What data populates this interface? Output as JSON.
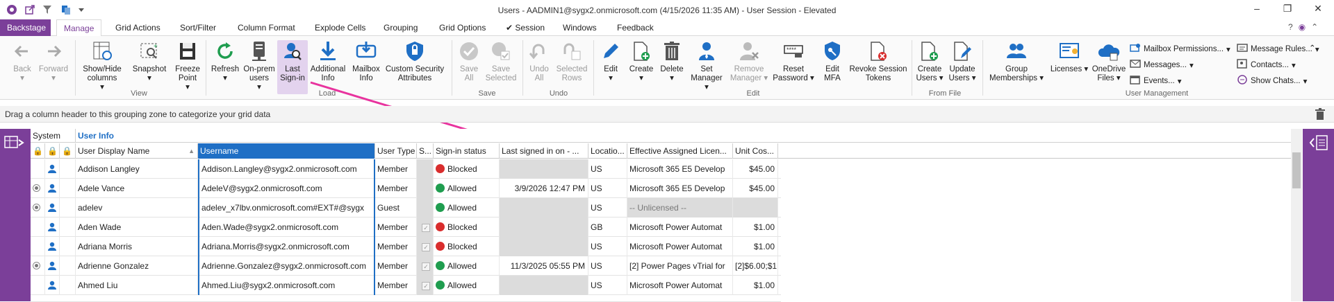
{
  "window": {
    "title": "Users - AADMIN1@sygx2.onmicrosoft.com (4/15/2026 11:35 AM) - User Session - Elevated"
  },
  "menu": {
    "tabs": [
      "Backstage",
      "Manage",
      "Grid Actions",
      "Sort/Filter",
      "Column Format",
      "Explode Cells",
      "Grouping",
      "Grid Options",
      "Session",
      "Windows",
      "Feedback"
    ],
    "session_check": "✔"
  },
  "ribbon": {
    "view": {
      "back": "Back",
      "forward": "Forward",
      "show_hide": "Show/Hide columns",
      "snapshot": "Snapshot",
      "freeze": "Freeze Point",
      "label": "View"
    },
    "load": {
      "refresh": "Refresh",
      "onprem": "On-prem users",
      "last_signin": "Last Sign-in",
      "additional": "Additional Info",
      "mailbox": "Mailbox Info",
      "custom": "Custom Security Attributes",
      "label": "Load"
    },
    "save": {
      "save_all": "Save All",
      "save_selected": "Save Selected",
      "label": "Save"
    },
    "undo": {
      "undo_all": "Undo All",
      "selected_rows": "Selected Rows",
      "label": "Undo"
    },
    "edit": {
      "edit": "Edit",
      "create": "Create",
      "delete": "Delete",
      "set_manager": "Set Manager",
      "remove_manager": "Remove Manager",
      "reset_password": "Reset Password",
      "edit_mfa": "Edit MFA",
      "revoke": "Revoke Session Tokens",
      "label": "Edit"
    },
    "fromfile": {
      "create_users": "Create Users",
      "update_users": "Update Users",
      "label": "From File"
    },
    "usermgmt": {
      "group": "Group Memberships",
      "licenses": "Licenses",
      "onedrive": "OneDrive Files",
      "mailbox_perm": "Mailbox Permissions...",
      "messages": "Messages...",
      "events": "Events...",
      "message_rules": "Message Rules...",
      "contacts": "Contacts...",
      "show_chats": "Show Chats...",
      "label": "User Management"
    }
  },
  "groupzone": {
    "text": "Drag a column header to this grouping zone to categorize your grid data"
  },
  "grid": {
    "bands": {
      "system": "System",
      "user_info": "User Info"
    },
    "columns": [
      "User Display Name",
      "Username",
      "User Type",
      "S...",
      "Sign-in status",
      "Last signed in on - ...",
      "Locatio...",
      "Effective Assigned Licen...",
      "Unit Cos..."
    ],
    "rows": [
      {
        "name": "Addison Langley",
        "username": "Addison.Langley@sygx2.onmicrosoft.com",
        "type": "Member",
        "status": "Blocked",
        "last": "",
        "loc": "US",
        "license": "Microsoft 365 E5 Develop",
        "cost": "$45.00"
      },
      {
        "name": "Adele Vance",
        "username": "AdeleV@sygx2.onmicrosoft.com",
        "type": "Member",
        "status": "Allowed",
        "last": "3/9/2026 12:47 PM",
        "loc": "US",
        "license": "Microsoft 365 E5 Develop",
        "cost": "$45.00"
      },
      {
        "name": "adelev",
        "username": "adelev_x7lbv.onmicrosoft.com#EXT#@sygx",
        "type": "Guest",
        "status": "Allowed",
        "last": "",
        "loc": "US",
        "license": "-- Unlicensed --",
        "cost": ""
      },
      {
        "name": "Aden Wade",
        "username": "Aden.Wade@sygx2.onmicrosoft.com",
        "type": "Member",
        "status": "Blocked",
        "last": "",
        "loc": "GB",
        "license": "Microsoft Power Automat",
        "cost": "$1.00"
      },
      {
        "name": "Adriana Morris",
        "username": "Adriana.Morris@sygx2.onmicrosoft.com",
        "type": "Member",
        "status": "Blocked",
        "last": "",
        "loc": "US",
        "license": "Microsoft Power Automat",
        "cost": "$1.00"
      },
      {
        "name": "Adrienne Gonzalez",
        "username": "Adrienne.Gonzalez@sygx2.onmicrosoft.com",
        "type": "Member",
        "status": "Allowed",
        "last": "11/3/2025 05:55 PM",
        "loc": "US",
        "license": "[2] Power Pages vTrial for",
        "cost": "[2]$6.00;$1"
      },
      {
        "name": "Ahmed Liu",
        "username": "Ahmed.Liu@sygx2.onmicrosoft.com",
        "type": "Member",
        "status": "Allowed",
        "last": "",
        "loc": "US",
        "license": "Microsoft Power Automat",
        "cost": "$1.00"
      }
    ]
  },
  "colors": {
    "accent": "#7b3f99",
    "blue": "#1f6fc5",
    "arrow": "#e8339e",
    "blocked": "#d92d2d",
    "allowed": "#1f9d4f"
  }
}
